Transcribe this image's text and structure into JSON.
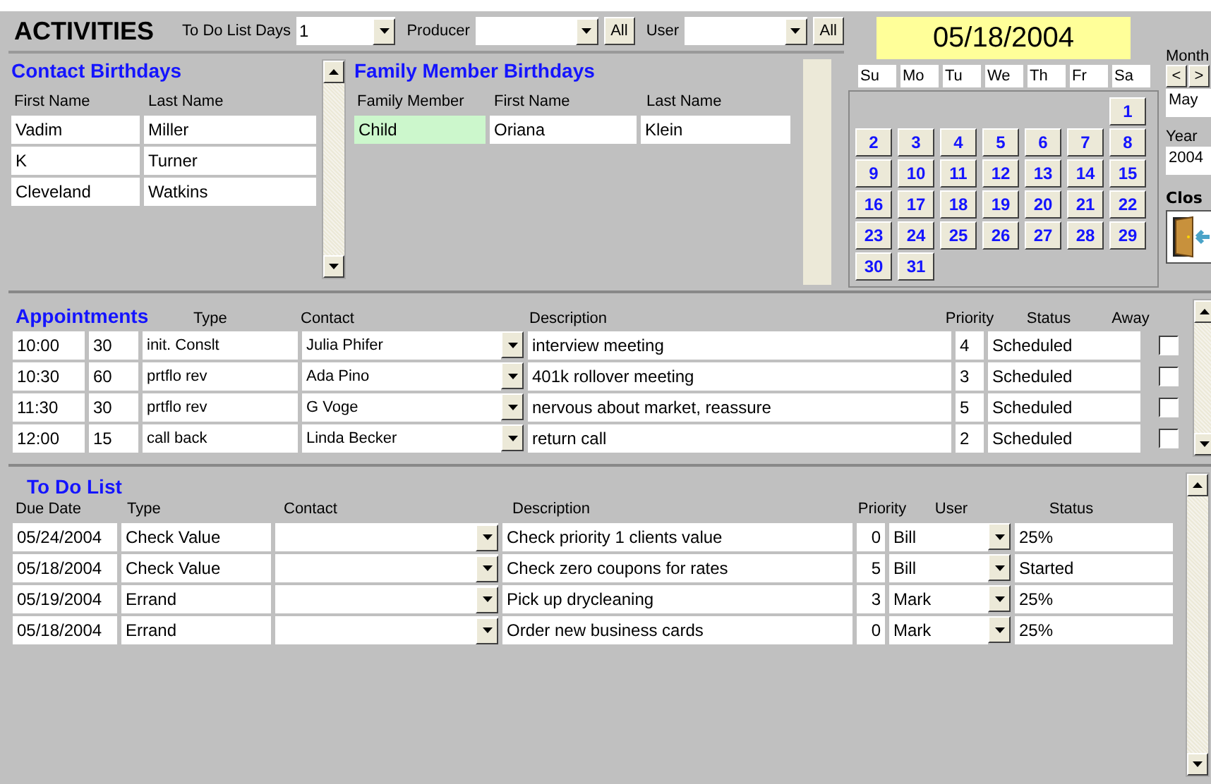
{
  "title": "ACTIVITIES",
  "filters": [
    {
      "kind": "combo",
      "label": "To Do List Days",
      "value": "1"
    },
    {
      "kind": "combo_all",
      "label": "Producer",
      "button": "All"
    },
    {
      "kind": "combo_all",
      "label": "User",
      "button": "All"
    }
  ],
  "contact_birthdays": {
    "heading": "Contact Birthdays",
    "columns": [
      "First Name",
      "Last Name"
    ],
    "rows": [
      [
        "Vadim",
        "Miller"
      ],
      [
        "K",
        "Turner"
      ],
      [
        "Cleveland",
        "Watkins"
      ]
    ]
  },
  "family_birthdays": {
    "heading": "Family Member Birthdays",
    "columns": [
      "Family Member",
      "First Name",
      "Last Name"
    ],
    "rows": [
      [
        "Child",
        "Oriana",
        "Klein"
      ]
    ]
  },
  "calendar": {
    "date": "05/18/2004",
    "weekdays": [
      "Su",
      "Mo",
      "Tu",
      "We",
      "Th",
      "Fr",
      "Sa"
    ],
    "weeks": [
      [
        {
          "kind": "blank"
        },
        {
          "kind": "blank"
        },
        {
          "kind": "blank"
        },
        {
          "kind": "blank"
        },
        {
          "kind": "blank"
        },
        {
          "kind": "blank"
        },
        {
          "kind": "day",
          "day": "1"
        }
      ],
      [
        {
          "kind": "day",
          "day": "2"
        },
        {
          "kind": "day",
          "day": "3"
        },
        {
          "kind": "day",
          "day": "4"
        },
        {
          "kind": "day",
          "day": "5"
        },
        {
          "kind": "day",
          "day": "6"
        },
        {
          "kind": "day",
          "day": "7"
        },
        {
          "kind": "day",
          "day": "8"
        }
      ],
      [
        {
          "kind": "day",
          "day": "9"
        },
        {
          "kind": "day",
          "day": "10"
        },
        {
          "kind": "day",
          "day": "11"
        },
        {
          "kind": "day",
          "day": "12"
        },
        {
          "kind": "day",
          "day": "13"
        },
        {
          "kind": "day",
          "day": "14"
        },
        {
          "kind": "day",
          "day": "15"
        }
      ],
      [
        {
          "kind": "day",
          "day": "16"
        },
        {
          "kind": "day",
          "day": "17"
        },
        {
          "kind": "day",
          "day": "18"
        },
        {
          "kind": "day",
          "day": "19"
        },
        {
          "kind": "day",
          "day": "20"
        },
        {
          "kind": "day",
          "day": "21"
        },
        {
          "kind": "day",
          "day": "22"
        }
      ],
      [
        {
          "kind": "day",
          "day": "23"
        },
        {
          "kind": "day",
          "day": "24"
        },
        {
          "kind": "day",
          "day": "25"
        },
        {
          "kind": "day",
          "day": "26"
        },
        {
          "kind": "day",
          "day": "27"
        },
        {
          "kind": "day",
          "day": "28"
        },
        {
          "kind": "day",
          "day": "29"
        }
      ],
      [
        {
          "kind": "day",
          "day": "30"
        },
        {
          "kind": "day",
          "day": "31"
        },
        {
          "kind": "blank"
        },
        {
          "kind": "blank"
        },
        {
          "kind": "blank"
        },
        {
          "kind": "blank"
        },
        {
          "kind": "blank"
        }
      ]
    ],
    "month_label": "Month",
    "prev": "<",
    "next": ">",
    "month": "May",
    "year_label": "Year",
    "year": "2004",
    "close_label": "Clos"
  },
  "appointments": {
    "heading": "Appointments",
    "columns": [
      "Type",
      "Contact",
      "Description",
      "Priority",
      "Status",
      "Away"
    ],
    "rows": [
      {
        "time": "10:00",
        "duration": "30",
        "type": "init. Conslt",
        "contact": "Julia Phifer",
        "description": "interview meeting",
        "priority": "4",
        "status": "Scheduled",
        "away": false
      },
      {
        "time": "10:30",
        "duration": "60",
        "type": "prtflo rev",
        "contact": "Ada Pino",
        "description": "401k rollover meeting",
        "priority": "3",
        "status": "Scheduled",
        "away": false
      },
      {
        "time": "11:30",
        "duration": "30",
        "type": "prtflo rev",
        "contact": "G Voge",
        "description": "nervous about market, reassure",
        "priority": "5",
        "status": "Scheduled",
        "away": false
      },
      {
        "time": "12:00",
        "duration": "15",
        "type": "call back",
        "contact": "Linda Becker",
        "description": "return call",
        "priority": "2",
        "status": "Scheduled",
        "away": false
      }
    ]
  },
  "todo": {
    "heading": "To Do List",
    "columns": [
      "Due Date",
      "Type",
      "Contact",
      "Description",
      "Priority",
      "User",
      "Status"
    ],
    "rows": [
      {
        "due": "05/24/2004",
        "type": "Check Value",
        "description": "Check priority 1 clients value",
        "priority": "0",
        "user": "Bill",
        "status": "25%"
      },
      {
        "due": "05/18/2004",
        "type": "Check Value",
        "description": "Check zero coupons for rates",
        "priority": "5",
        "user": "Bill",
        "status": "Started"
      },
      {
        "due": "05/19/2004",
        "type": "Errand",
        "description": "Pick up drycleaning",
        "priority": "3",
        "user": "Mark",
        "status": "25%"
      },
      {
        "due": "05/18/2004",
        "type": "Errand",
        "description": "Order new business cards",
        "priority": "0",
        "user": "Mark",
        "status": "25%"
      }
    ]
  }
}
